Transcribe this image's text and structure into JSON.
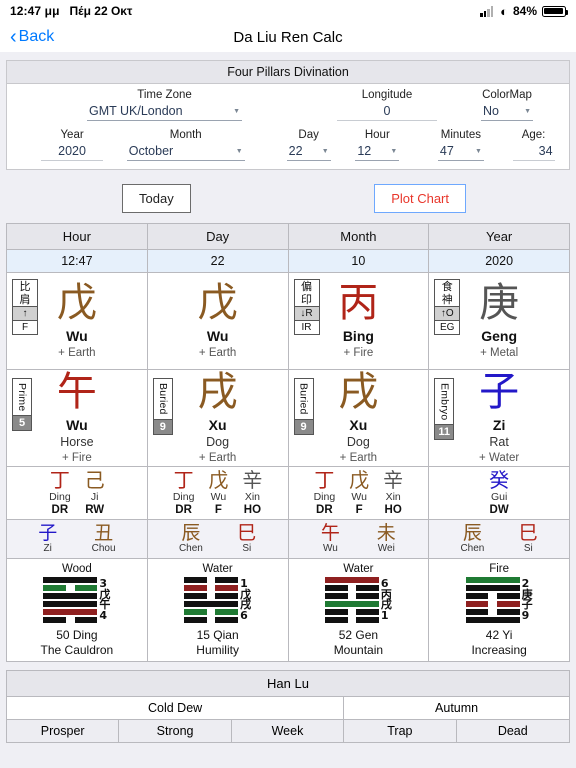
{
  "status": {
    "time": "12:47 μμ",
    "date": "Πέμ 22 Οκτ",
    "battery_pct": "84%"
  },
  "nav": {
    "back_label": "Back",
    "title": "Da Liu Ren Calc"
  },
  "form": {
    "panel_title": "Four Pillars Divination",
    "timezone": {
      "label": "Time Zone",
      "value": "GMT UK/London"
    },
    "longitude": {
      "label": "Longitude",
      "value": "0"
    },
    "colormap": {
      "label": "ColorMap",
      "value": "No"
    },
    "year": {
      "label": "Year",
      "value": "2020"
    },
    "month": {
      "label": "Month",
      "value": "October"
    },
    "day": {
      "label": "Day",
      "value": "22"
    },
    "hour": {
      "label": "Hour",
      "value": "12"
    },
    "minutes": {
      "label": "Minutes",
      "value": "47"
    },
    "age": {
      "label": "Age:",
      "value": "34"
    }
  },
  "buttons": {
    "today": "Today",
    "plot_chart": "Plot Chart"
  },
  "colors": {
    "wood": "#1f7a33",
    "fire": "#b02418",
    "earth": "#8a5a22",
    "metal": "#555555",
    "water": "#2318c8",
    "accent": "#007aff",
    "plot_text": "#e8362b"
  },
  "grid": {
    "headers": [
      "Hour",
      "Day",
      "Month",
      "Year"
    ],
    "subheaders": [
      "12:47",
      "22",
      "10",
      "2020"
    ],
    "stems": [
      {
        "badge": {
          "cn": "比肩",
          "mid": "↑",
          "bot": "F"
        },
        "glyph": "戊",
        "name": "Wu",
        "element": "+ Earth",
        "color": "#8a5a22"
      },
      {
        "badge": null,
        "glyph": "戊",
        "name": "Wu",
        "element": "+ Earth",
        "color": "#8a5a22"
      },
      {
        "badge": {
          "cn": "偏印",
          "mid": "↓R",
          "bot": "IR"
        },
        "glyph": "丙",
        "name": "Bing",
        "element": "+ Fire",
        "color": "#b02418"
      },
      {
        "badge": {
          "cn": "食神",
          "mid": "↑O",
          "bot": "EG"
        },
        "glyph": "庚",
        "name": "Geng",
        "element": "+ Metal",
        "color": "#555555"
      }
    ],
    "branches": [
      {
        "badge": {
          "text": "Prime",
          "num": "5"
        },
        "glyph": "午",
        "name": "Wu",
        "animal": "Horse",
        "element": "+ Fire",
        "color": "#b02418"
      },
      {
        "badge": {
          "text": "Buried",
          "num": "9"
        },
        "glyph": "戌",
        "name": "Xu",
        "animal": "Dog",
        "element": "+ Earth",
        "color": "#8a5a22"
      },
      {
        "badge": {
          "text": "Buried",
          "num": "9"
        },
        "glyph": "戌",
        "name": "Xu",
        "animal": "Dog",
        "element": "+ Earth",
        "color": "#8a5a22"
      },
      {
        "badge": {
          "text": "Embryo",
          "num": "11"
        },
        "glyph": "子",
        "name": "Zi",
        "animal": "Rat",
        "element": "+ Water",
        "color": "#2318c8"
      }
    ],
    "hidden_stems": [
      [
        {
          "glyph": "丁",
          "name": "Ding",
          "code": "DR",
          "color": "#b02418"
        },
        {
          "glyph": "己",
          "name": "Ji",
          "code": "RW",
          "color": "#8a5a22"
        }
      ],
      [
        {
          "glyph": "丁",
          "name": "Ding",
          "code": "DR",
          "color": "#b02418"
        },
        {
          "glyph": "戊",
          "name": "Wu",
          "code": "F",
          "color": "#8a5a22"
        },
        {
          "glyph": "辛",
          "name": "Xin",
          "code": "HO",
          "color": "#555555"
        }
      ],
      [
        {
          "glyph": "丁",
          "name": "Ding",
          "code": "DR",
          "color": "#b02418"
        },
        {
          "glyph": "戊",
          "name": "Wu",
          "code": "F",
          "color": "#8a5a22"
        },
        {
          "glyph": "辛",
          "name": "Xin",
          "code": "HO",
          "color": "#555555"
        }
      ],
      [
        {
          "glyph": "癸",
          "name": "Gui",
          "code": "DW",
          "color": "#2318c8"
        }
      ]
    ],
    "branch_pairs": [
      [
        {
          "glyph": "子",
          "name": "Zi",
          "color": "#2318c8"
        },
        {
          "glyph": "丑",
          "name": "Chou",
          "color": "#8a5a22"
        }
      ],
      [
        {
          "glyph": "辰",
          "name": "Chen",
          "color": "#8a5a22"
        },
        {
          "glyph": "巳",
          "name": "Si",
          "color": "#b02418"
        }
      ],
      [
        {
          "glyph": "午",
          "name": "Wu",
          "color": "#b02418"
        },
        {
          "glyph": "未",
          "name": "Wei",
          "color": "#8a5a22"
        }
      ],
      [
        {
          "glyph": "辰",
          "name": "Chen",
          "color": "#8a5a22"
        },
        {
          "glyph": "巳",
          "name": "Si",
          "color": "#b02418"
        }
      ]
    ],
    "hexagrams": [
      {
        "element": "Wood",
        "lines": [
          {
            "type": "full",
            "color": "#111111"
          },
          {
            "type": "broken",
            "color": "#1f7a33"
          },
          {
            "type": "full",
            "color": "#111111"
          },
          {
            "type": "full",
            "color": "#111111"
          },
          {
            "type": "full",
            "color": "#8f2020"
          },
          {
            "type": "broken",
            "color": "#111111"
          }
        ],
        "side": [
          "3",
          "戊",
          "午",
          "4"
        ],
        "number_name": "50 Ding",
        "title": "The Cauldron"
      },
      {
        "element": "Water",
        "lines": [
          {
            "type": "broken",
            "color": "#111111"
          },
          {
            "type": "broken",
            "color": "#8f2020"
          },
          {
            "type": "broken",
            "color": "#111111"
          },
          {
            "type": "full",
            "color": "#111111"
          },
          {
            "type": "broken",
            "color": "#1f7a33"
          },
          {
            "type": "broken",
            "color": "#111111"
          }
        ],
        "side": [
          "1",
          "戊",
          "戌",
          "6"
        ],
        "number_name": "15 Qian",
        "title": "Humility"
      },
      {
        "element": "Water",
        "lines": [
          {
            "type": "full",
            "color": "#8f2020"
          },
          {
            "type": "broken",
            "color": "#111111"
          },
          {
            "type": "broken",
            "color": "#111111"
          },
          {
            "type": "full",
            "color": "#1f7a33"
          },
          {
            "type": "broken",
            "color": "#111111"
          },
          {
            "type": "broken",
            "color": "#111111"
          }
        ],
        "side": [
          "6",
          "丙",
          "戌",
          "1"
        ],
        "number_name": "52 Gen",
        "title": "Mountain"
      },
      {
        "element": "Fire",
        "lines": [
          {
            "type": "full",
            "color": "#1f7a33"
          },
          {
            "type": "full",
            "color": "#111111"
          },
          {
            "type": "broken",
            "color": "#111111"
          },
          {
            "type": "broken",
            "color": "#8f2020"
          },
          {
            "type": "broken",
            "color": "#111111"
          },
          {
            "type": "full",
            "color": "#111111"
          }
        ],
        "side": [
          "2",
          "庚",
          "子",
          "9"
        ],
        "number_name": "42 Yi",
        "title": "Increasing"
      }
    ]
  },
  "bottom": {
    "title": "Han Lu",
    "season": [
      "Cold Dew",
      "Autumn"
    ],
    "states": [
      "Prosper",
      "Strong",
      "Week",
      "Trap",
      "Dead"
    ]
  }
}
